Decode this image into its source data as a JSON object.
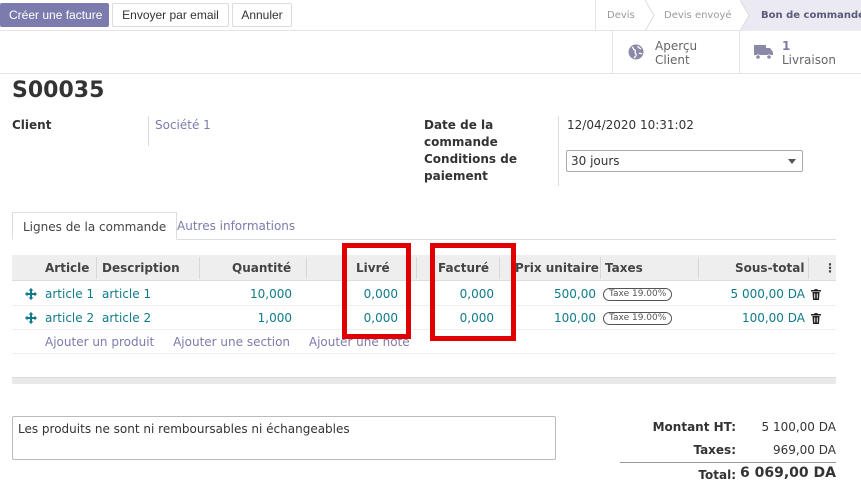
{
  "toolbar": {
    "create_invoice": "Créer une facture",
    "send_email": "Envoyer par email",
    "cancel": "Annuler"
  },
  "statusbar": {
    "steps": [
      "Devis",
      "Devis envoyé",
      "Bon de commande"
    ],
    "active_step": "Bon de commande"
  },
  "smart_buttons": {
    "preview_line1": "Aperçu",
    "preview_line2": "Client",
    "delivery_count": "1",
    "delivery_label": "Livraison"
  },
  "record": {
    "name": "S00035",
    "client_label": "Client",
    "client_value": "Société 1",
    "order_date_label_l1": "Date de la",
    "order_date_label_l2": "commande",
    "order_date_value": "12/04/2020 10:31:02",
    "payment_terms_label_l1": "Conditions de",
    "payment_terms_label_l2": "paiement",
    "payment_terms_value": "30 jours"
  },
  "tabs": [
    {
      "label": "Lignes de la commande",
      "active": true
    },
    {
      "label": "Autres informations",
      "active": false
    }
  ],
  "table": {
    "headers": {
      "article": "Article",
      "description": "Description",
      "quantity": "Quantité",
      "delivered": "Livré",
      "invoiced": "Facturé",
      "unit_price": "Prix unitaire",
      "taxes": "Taxes",
      "subtotal": "Sous-total"
    },
    "rows": [
      {
        "article": "article 1",
        "description": "article 1",
        "quantity": "10,000",
        "delivered": "0,000",
        "invoiced": "0,000",
        "unit_price": "500,00",
        "tax": "Taxe 19.00%",
        "subtotal": "5 000,00 DA"
      },
      {
        "article": "article 2",
        "description": "article 2",
        "quantity": "1,000",
        "delivered": "0,000",
        "invoiced": "0,000",
        "unit_price": "100,00",
        "tax": "Taxe 19.00%",
        "subtotal": "100,00 DA"
      }
    ],
    "add_links": {
      "add_product": "Ajouter un produit",
      "add_section": "Ajouter une section",
      "add_note": "Ajouter une note"
    }
  },
  "note": "Les produits ne sont ni remboursables ni échangeables",
  "totals": {
    "untaxed_label": "Montant HT:",
    "untaxed_value": "5 100,00 DA",
    "taxes_label": "Taxes:",
    "taxes_value": "969,00 DA",
    "total_label": "Total:",
    "total_value": "6 069,00 DA"
  },
  "colors": {
    "primary": "#7c7bad",
    "link": "#0f7b8a",
    "highlight": "#e00000"
  }
}
